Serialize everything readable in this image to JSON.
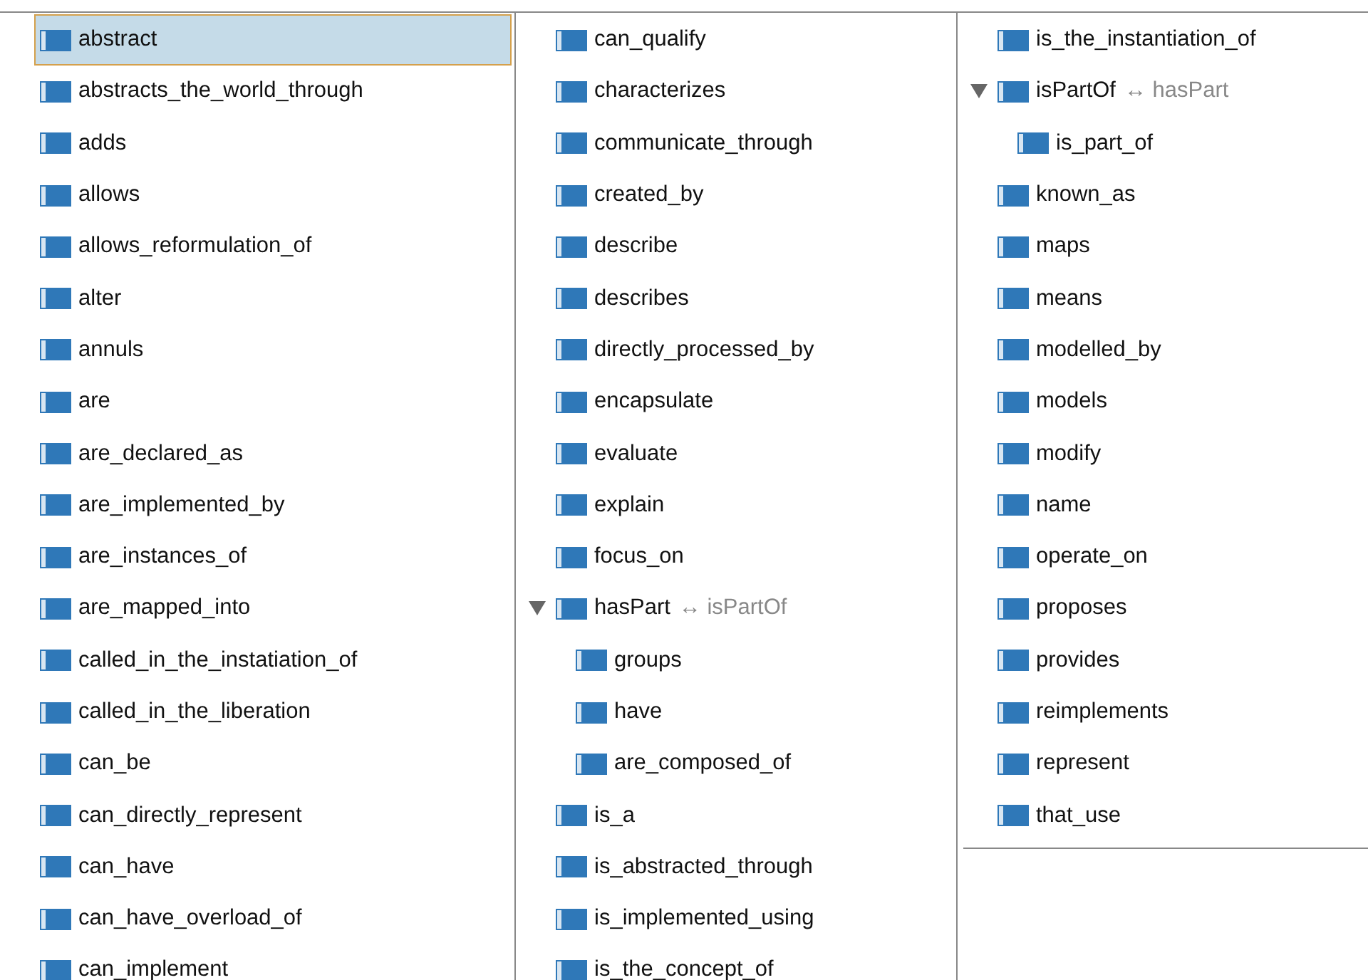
{
  "columns": [
    {
      "items": [
        {
          "label": "abstract",
          "selected": true
        },
        {
          "label": "abstracts_the_world_through",
          "selected": false
        },
        {
          "label": "adds",
          "selected": false
        },
        {
          "label": "allows",
          "selected": false
        },
        {
          "label": "allows_reformulation_of",
          "selected": false
        },
        {
          "label": "alter",
          "selected": false
        },
        {
          "label": "annuls",
          "selected": false
        },
        {
          "label": "are",
          "selected": false
        },
        {
          "label": "are_declared_as",
          "selected": false
        },
        {
          "label": "are_implemented_by",
          "selected": false
        },
        {
          "label": "are_instances_of",
          "selected": false
        },
        {
          "label": "are_mapped_into",
          "selected": false
        },
        {
          "label": "called_in_the_instatiation_of",
          "selected": false
        },
        {
          "label": "called_in_the_liberation",
          "selected": false
        },
        {
          "label": "can_be",
          "selected": false
        },
        {
          "label": "can_directly_represent",
          "selected": false
        },
        {
          "label": "can_have",
          "selected": false
        },
        {
          "label": "can_have_overload_of",
          "selected": false
        },
        {
          "label": "can_implement",
          "selected": false
        }
      ]
    },
    {
      "items": [
        {
          "label": "can_qualify",
          "selected": false
        },
        {
          "label": "characterizes",
          "selected": false
        },
        {
          "label": "communicate_through",
          "selected": false
        },
        {
          "label": "created_by",
          "selected": false
        },
        {
          "label": "describe",
          "selected": false
        },
        {
          "label": "describes",
          "selected": false
        },
        {
          "label": "directly_processed_by",
          "selected": false
        },
        {
          "label": "encapsulate",
          "selected": false
        },
        {
          "label": "evaluate",
          "selected": false
        },
        {
          "label": "explain",
          "selected": false
        },
        {
          "label": "focus_on",
          "selected": false
        },
        {
          "label": "hasPart",
          "inverse": "↔ isPartOf",
          "selected": false,
          "expanded": true,
          "children": [
            {
              "label": "groups",
              "selected": false
            },
            {
              "label": "have",
              "selected": false
            },
            {
              "label": "are_composed_of",
              "selected": false
            }
          ]
        },
        {
          "label": "is_a",
          "selected": false
        },
        {
          "label": "is_abstracted_through",
          "selected": false
        },
        {
          "label": "is_implemented_using",
          "selected": false
        },
        {
          "label": "is_the_concept_of",
          "selected": false
        }
      ]
    },
    {
      "items": [
        {
          "label": "is_the_instantiation_of",
          "selected": false
        },
        {
          "label": "isPartOf",
          "inverse": "↔ hasPart",
          "selected": false,
          "expanded": true,
          "children": [
            {
              "label": "is_part_of",
              "selected": false
            }
          ]
        },
        {
          "label": "known_as",
          "selected": false
        },
        {
          "label": "maps",
          "selected": false
        },
        {
          "label": "means",
          "selected": false
        },
        {
          "label": "modelled_by",
          "selected": false
        },
        {
          "label": "models",
          "selected": false
        },
        {
          "label": "modify",
          "selected": false
        },
        {
          "label": "name",
          "selected": false
        },
        {
          "label": "operate_on",
          "selected": false
        },
        {
          "label": "proposes",
          "selected": false
        },
        {
          "label": "provides",
          "selected": false
        },
        {
          "label": "reimplements",
          "selected": false
        },
        {
          "label": "represent",
          "selected": false
        },
        {
          "label": "that_use",
          "selected": false
        }
      ]
    }
  ]
}
